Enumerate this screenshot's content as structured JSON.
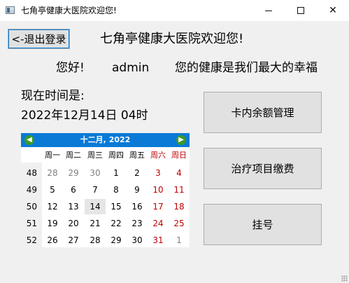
{
  "window": {
    "title": "七角亭健康大医院欢迎您!"
  },
  "header": {
    "logout_label": "<-退出登录",
    "welcome": "七角亭健康大医院欢迎您!",
    "hello": "您好!",
    "username": "admin",
    "slogan": "您的健康是我们最大的幸福"
  },
  "time": {
    "label": "现在时间是:",
    "value": "2022年12月14日 04时"
  },
  "actions": {
    "card_balance": "卡内余额管理",
    "treatment_payment": "治疗项目缴费",
    "register": "挂号"
  },
  "calendar": {
    "title": "十二月, 2022",
    "weekdays": [
      "周一",
      "周二",
      "周三",
      "周四",
      "周五",
      "周六",
      "周日"
    ],
    "weeks": [
      {
        "no": "48",
        "days": [
          "28",
          "29",
          "30",
          "1",
          "2",
          "3",
          "4"
        ]
      },
      {
        "no": "49",
        "days": [
          "5",
          "6",
          "7",
          "8",
          "9",
          "10",
          "11"
        ]
      },
      {
        "no": "50",
        "days": [
          "12",
          "13",
          "14",
          "15",
          "16",
          "17",
          "18"
        ]
      },
      {
        "no": "51",
        "days": [
          "19",
          "20",
          "21",
          "22",
          "23",
          "24",
          "25"
        ]
      },
      {
        "no": "52",
        "days": [
          "26",
          "27",
          "28",
          "29",
          "30",
          "31",
          "1"
        ]
      }
    ],
    "selected_day": "14",
    "colors": {
      "header": "#0a7ad6",
      "weekend": "#c00000",
      "other_month": "#808080"
    }
  }
}
